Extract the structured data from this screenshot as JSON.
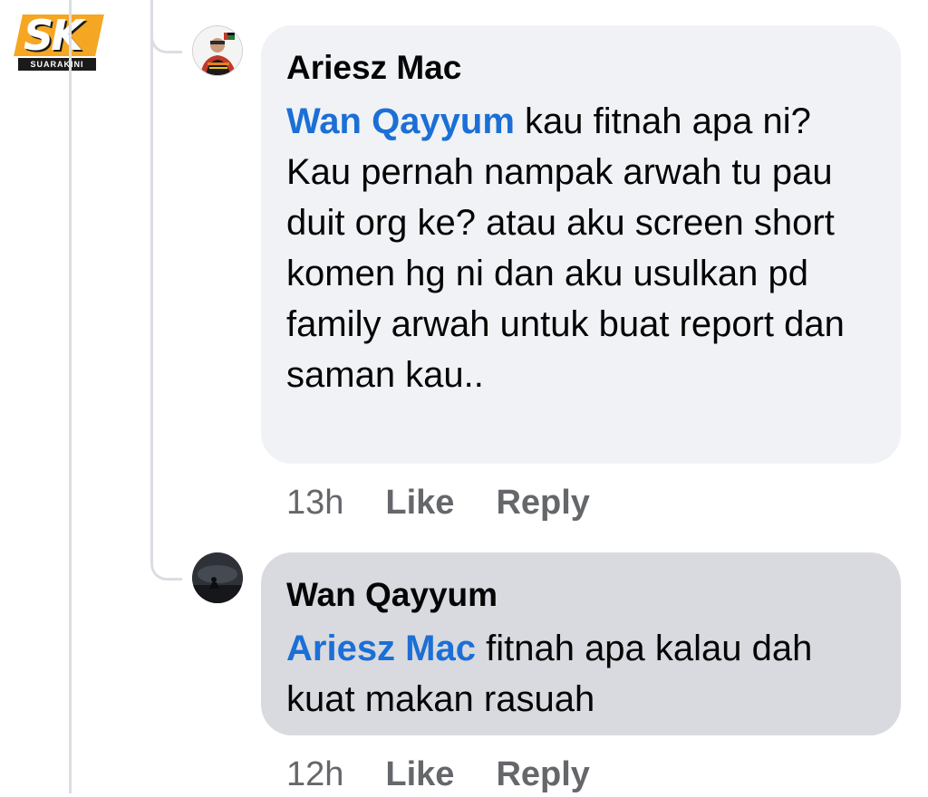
{
  "watermark": {
    "letters": "SK",
    "name": "SUARAKINI"
  },
  "comments": [
    {
      "author": "Ariesz Mac",
      "mention": "Wan Qayyum",
      "text": " kau fitnah apa ni? Kau pernah nampak arwah tu pau duit org ke? atau aku screen short komen hg ni dan aku usulkan pd family arwah untuk buat report dan saman kau..",
      "time": "13h",
      "like_label": "Like",
      "reply_label": "Reply"
    },
    {
      "author": "Wan Qayyum",
      "mention": "Ariesz Mac",
      "text": " fitnah apa kalau dah kuat makan rasuah",
      "time": "12h",
      "like_label": "Like",
      "reply_label": "Reply"
    }
  ],
  "colors": {
    "mention": "#1b6fd6",
    "bubble_default": "#f0f2f5",
    "bubble_highlight": "#d8dadf",
    "meta_text": "#65676b",
    "logo_accent": "#f5a623"
  }
}
